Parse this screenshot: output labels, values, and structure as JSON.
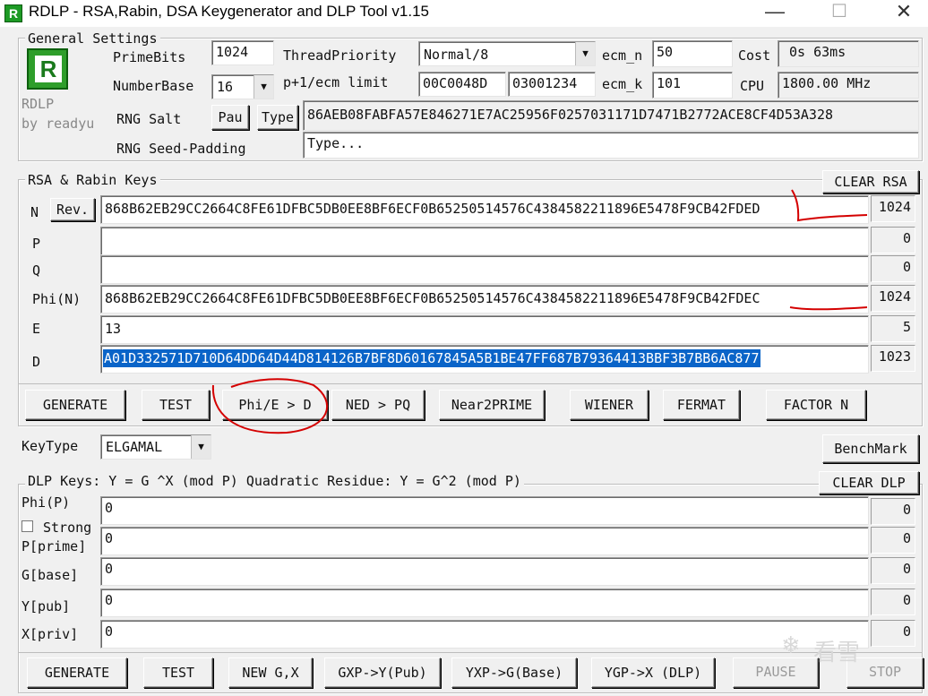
{
  "window": {
    "title": "RDLP - RSA,Rabin, DSA Keygenerator and DLP Tool v1.15",
    "icon_letter": "R",
    "minimize": "—",
    "maximize": "☐",
    "close": "✕"
  },
  "general": {
    "label": "General Settings",
    "logo_letter": "R",
    "brand": "RDLP",
    "author": "by readyu",
    "prime_bits_label": "PrimeBits",
    "prime_bits": "1024",
    "number_base_label": "NumberBase",
    "number_base": "16",
    "thread_priority_label": "ThreadPriority",
    "thread_priority": "Normal/8",
    "ecm_n_label": "ecm_n",
    "ecm_n": "50",
    "cost_label": "Cost",
    "cost": "0s 63ms",
    "p1ecm_label": "p+1/ecm limit",
    "p1ecm_1": "00C0048D",
    "p1ecm_2": "03001234",
    "ecm_k_label": "ecm_k",
    "ecm_k": "101",
    "cpu_label": "CPU",
    "cpu": "1800.00 MHz",
    "rng_salt_label": "RNG Salt",
    "pau_label": "Pau",
    "type_label": "Type",
    "rng_salt": "86AEB08FABFA57E846271E7AC25956F0257031171D7471B2772ACE8CF4D53A328",
    "seed_padding_label": "RNG Seed-Padding",
    "seed_padding": "Type..."
  },
  "rsa": {
    "label": "RSA  & Rabin Keys",
    "clear_label": "CLEAR RSA",
    "rev_label": "Rev.",
    "n_label": "N",
    "n": "868B62EB29CC2664C8FE61DFBC5DB0EE8BF6ECF0B65250514576C4384582211896E5478F9CB42FDED",
    "n_bits": "1024",
    "p_label": "P",
    "p": "",
    "p_bits": "0",
    "q_label": "Q",
    "q": "",
    "q_bits": "0",
    "phi_label": "Phi(N)",
    "phi": "868B62EB29CC2664C8FE61DFBC5DB0EE8BF6ECF0B65250514576C4384582211896E5478F9CB42FDEC",
    "phi_bits": "1024",
    "e_label": "E",
    "e": "13",
    "e_bits": "5",
    "d_label": "D",
    "d": "A01D332571D710D64DD64D44D814126B7BF8D60167845A5B1BE47FF687B79364413BBF3B7BB6AC877",
    "d_bits": "1023",
    "buttons": [
      "GENERATE",
      "TEST",
      "Phi/E > D",
      "NED > PQ",
      "Near2PRIME",
      "WIENER",
      "FERMAT",
      "FACTOR N"
    ]
  },
  "keytype": {
    "label": "KeyType",
    "value": "ELGAMAL"
  },
  "benchmark_label": "BenchMark",
  "dlp": {
    "label": "DLP Keys: Y = G ^X (mod P)  Quadratic Residue: Y = G^2 (mod P)",
    "clear_label": "CLEAR DLP",
    "strong_label": "Strong",
    "rows": [
      {
        "label": "Phi(P)",
        "value": "0",
        "bits": "0"
      },
      {
        "label": "P[prime]",
        "value": "0",
        "bits": "0"
      },
      {
        "label": "G[base]",
        "value": "0",
        "bits": "0"
      },
      {
        "label": "Y[pub]",
        "value": "0",
        "bits": "0"
      },
      {
        "label": "X[priv]",
        "value": "0",
        "bits": "0"
      }
    ],
    "buttons": [
      "GENERATE",
      "TEST",
      "NEW G,X",
      "GXP->Y(Pub)",
      "YXP->G(Base)",
      "YGP->X (DLP)",
      "PAUSE",
      "STOP"
    ]
  },
  "watermark": "看雪"
}
